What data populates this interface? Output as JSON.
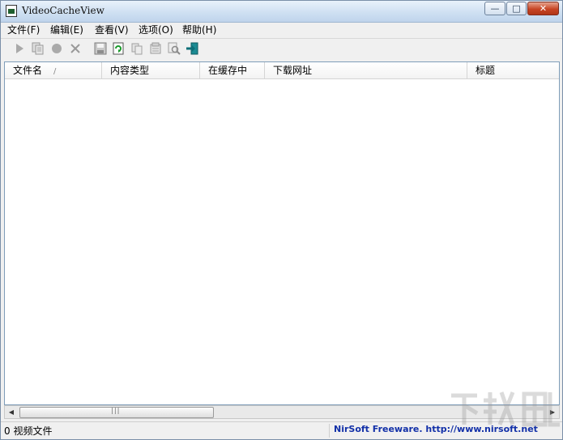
{
  "window": {
    "title": "VideoCacheView",
    "controls": {
      "minimize": "—",
      "maximize": "□",
      "close": "✕"
    }
  },
  "menu": [
    {
      "label": "文件(F)"
    },
    {
      "label": "编辑(E)"
    },
    {
      "label": "查看(V)"
    },
    {
      "label": "选项(O)"
    },
    {
      "label": "帮助(H)"
    }
  ],
  "toolbar": {
    "icons": [
      "play-icon",
      "copy-files-icon",
      "record-icon",
      "delete-icon",
      "save-icon",
      "refresh-icon",
      "copy-icon",
      "properties-icon",
      "find-icon",
      "exit-icon"
    ]
  },
  "table": {
    "columns": [
      {
        "label": "文件名"
      },
      {
        "label": "内容类型"
      },
      {
        "label": "在缓存中"
      },
      {
        "label": "下载网址"
      },
      {
        "label": "标题"
      }
    ],
    "sort_indicator": "/",
    "rows": []
  },
  "scrollbar": {
    "left_arrow": "◀",
    "right_arrow": "▶",
    "grip": "|||"
  },
  "status": {
    "count_text": "0 视频文件",
    "link_text": "NirSoft Freeware.  http://www.nirsoft.net"
  },
  "colors": {
    "link": "#1230a8",
    "accent": "#cfe0f2"
  }
}
